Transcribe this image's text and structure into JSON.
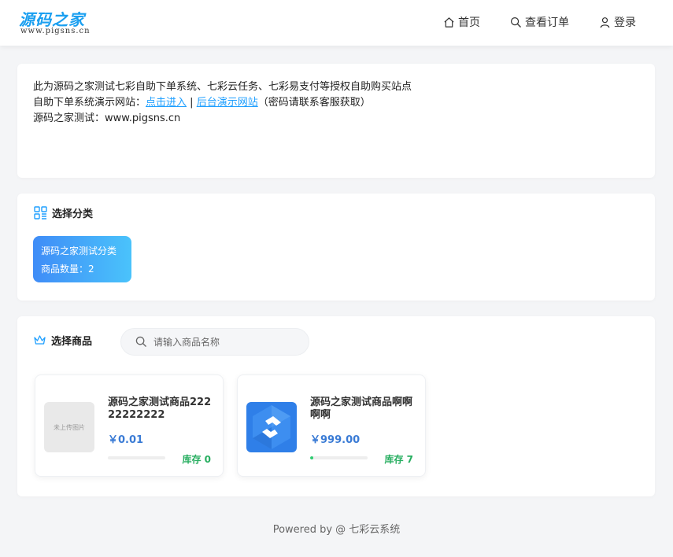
{
  "header": {
    "logo_text": "源码之家",
    "logo_sub": "www.pigsns.cn",
    "nav": [
      {
        "label": "首页",
        "icon": "home-icon"
      },
      {
        "label": "查看订单",
        "icon": "search-icon"
      },
      {
        "label": "登录",
        "icon": "user-icon"
      }
    ]
  },
  "notice": {
    "line1": "此为源码之家测试七彩自助下单系统、七彩云任务、七彩易支付等授权自助购买站点",
    "line2_prefix": "自助下单系统演示网站：",
    "link1": "点击进入",
    "separator": "|",
    "link2": "后台演示网站",
    "line2_suffix": "（密码请联系客服获取）",
    "line3": "源码之家测试：www.pigsns.cn"
  },
  "categories": {
    "title": "选择分类",
    "items": [
      {
        "name": "源码之家测试分类",
        "count_label": "商品数量：",
        "count": "2"
      }
    ]
  },
  "goods": {
    "title": "选择商品",
    "search_placeholder": "请输入商品名称",
    "items": [
      {
        "name": "源码之家测试商品22222222222",
        "price": "￥0.01",
        "stock_label": "库存 0",
        "stock_fraction": 0.0,
        "image_text": "未上传图片"
      },
      {
        "name": "源码之家测试商品啊啊啊啊",
        "price": "￥999.00",
        "stock_label": "库存 7",
        "stock_fraction": 0.05,
        "image_text": ""
      }
    ]
  },
  "footer": {
    "text": "Powered by @ 七彩云系统"
  },
  "colors": {
    "accent": "#1e9fff",
    "tile_start": "#3f8cf7",
    "tile_end": "#4ac3fb",
    "stock": "#27ae60",
    "price": "#3a7bd5"
  }
}
